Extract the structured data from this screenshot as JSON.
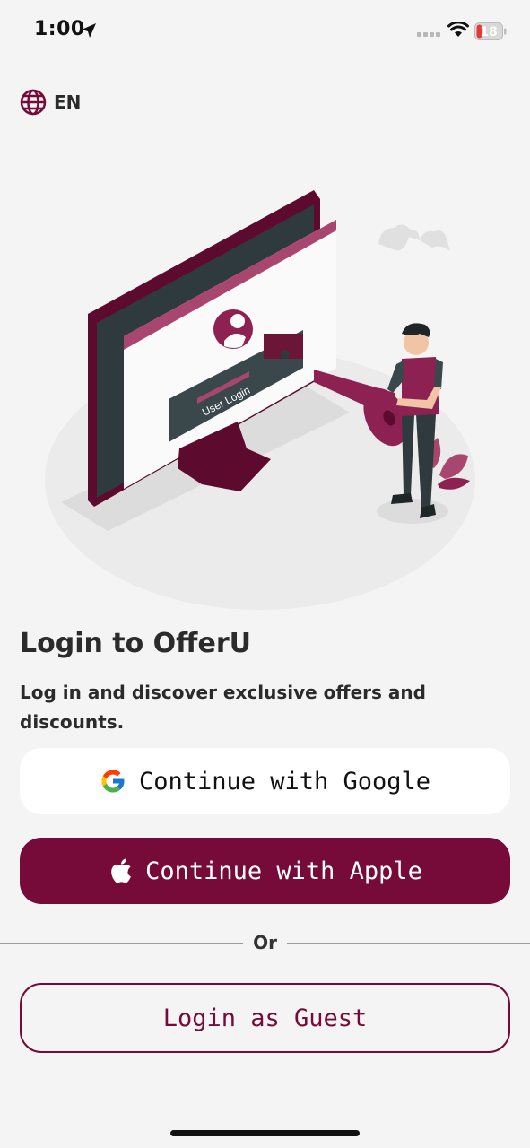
{
  "status_bar": {
    "time": "1:00",
    "battery": "18"
  },
  "language": {
    "label": "EN",
    "icon": "globe-icon"
  },
  "illustration": {
    "screen_text": "User Login"
  },
  "login": {
    "title": "Login to OfferU",
    "subtitle": "Log in and discover exclusive offers and discounts."
  },
  "buttons": {
    "google": "Continue with Google",
    "apple": "Continue with Apple",
    "or": "Or",
    "guest": "Login as Guest"
  },
  "colors": {
    "brand": "#760a38",
    "background": "#f4f4f4",
    "google_button_bg": "#ffffff"
  }
}
